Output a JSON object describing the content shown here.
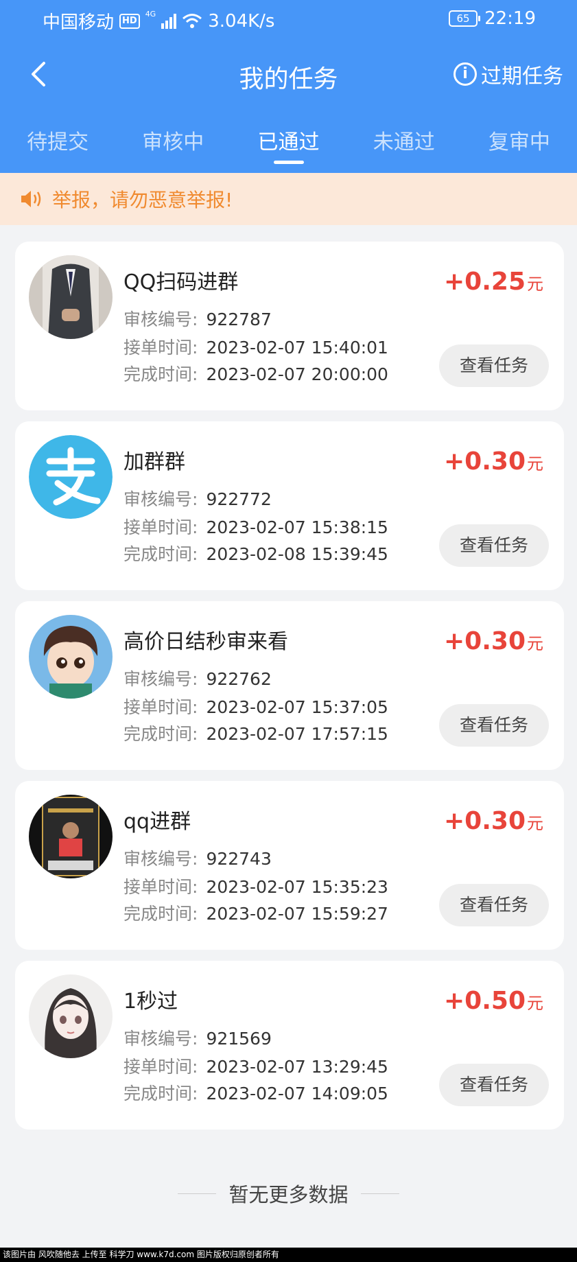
{
  "status_bar": {
    "carrier": "中国移动",
    "hd": "HD",
    "network": "4G",
    "speed": "3.04K/s",
    "battery": "65",
    "time": "22:19"
  },
  "nav": {
    "title": "我的任务",
    "expired_label": "过期任务"
  },
  "tabs": [
    {
      "label": "待提交",
      "active": false
    },
    {
      "label": "审核中",
      "active": false
    },
    {
      "label": "已通过",
      "active": true
    },
    {
      "label": "未通过",
      "active": false
    },
    {
      "label": "复审中",
      "active": false
    }
  ],
  "notice": {
    "text": "举报，请勿恶意举报!",
    "color": "#f08a2f"
  },
  "labels": {
    "review_no": "审核编号:",
    "accept_time": "接单时间:",
    "finish_time": "完成时间:",
    "view_button": "查看任务",
    "unit": "元"
  },
  "tasks": [
    {
      "title": "QQ扫码进群",
      "review_no": "922787",
      "accept_time": "2023-02-07 15:40:01",
      "finish_time": "2023-02-07 20:00:00",
      "reward": "+0.25",
      "avatar": "person-in-suit-avatar"
    },
    {
      "title": "加群群",
      "review_no": "922772",
      "accept_time": "2023-02-07 15:38:15",
      "finish_time": "2023-02-08 15:39:45",
      "reward": "+0.30",
      "avatar": "alipay-logo-avatar"
    },
    {
      "title": "高价日结秒审来看",
      "review_no": "922762",
      "accept_time": "2023-02-07 15:37:05",
      "finish_time": "2023-02-07 17:57:15",
      "reward": "+0.30",
      "avatar": "cartoon-boy-avatar"
    },
    {
      "title": "qq进群",
      "review_no": "922743",
      "accept_time": "2023-02-07 15:35:23",
      "finish_time": "2023-02-07 15:59:27",
      "reward": "+0.30",
      "avatar": "poster-avatar"
    },
    {
      "title": "1秒过",
      "review_no": "921569",
      "accept_time": "2023-02-07 13:29:45",
      "finish_time": "2023-02-07 14:09:05",
      "reward": "+0.50",
      "avatar": "anime-girl-avatar"
    }
  ],
  "footer": {
    "no_more": "暂无更多数据",
    "watermark": "该图片由 风吹随他去 上传至 科学刀 www.k7d.com 图片版权归原创者所有"
  },
  "colors": {
    "header": "#4796f8",
    "reward": "#e8443a",
    "notice_bg": "#fce8d9"
  }
}
